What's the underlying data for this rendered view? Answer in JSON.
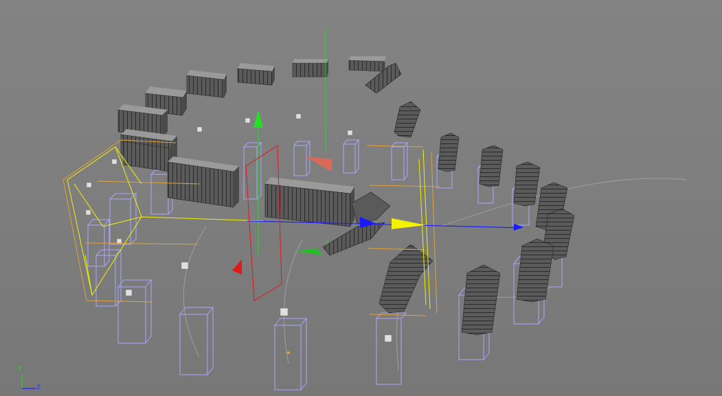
{
  "viewport": {
    "axis_gizmo": {
      "y_label": "Y",
      "z_label": "Z"
    }
  },
  "colors": {
    "background": "#808080",
    "x_axis": "#1a1aff",
    "y_axis": "#1fd81f",
    "z_axis": "#e01818",
    "selection_frame": "#ffff00",
    "bounding_box": "#e0a23a",
    "guide_wireframe": "#aaa6ff",
    "block": "#555555",
    "spline": "#a8a8a8"
  }
}
